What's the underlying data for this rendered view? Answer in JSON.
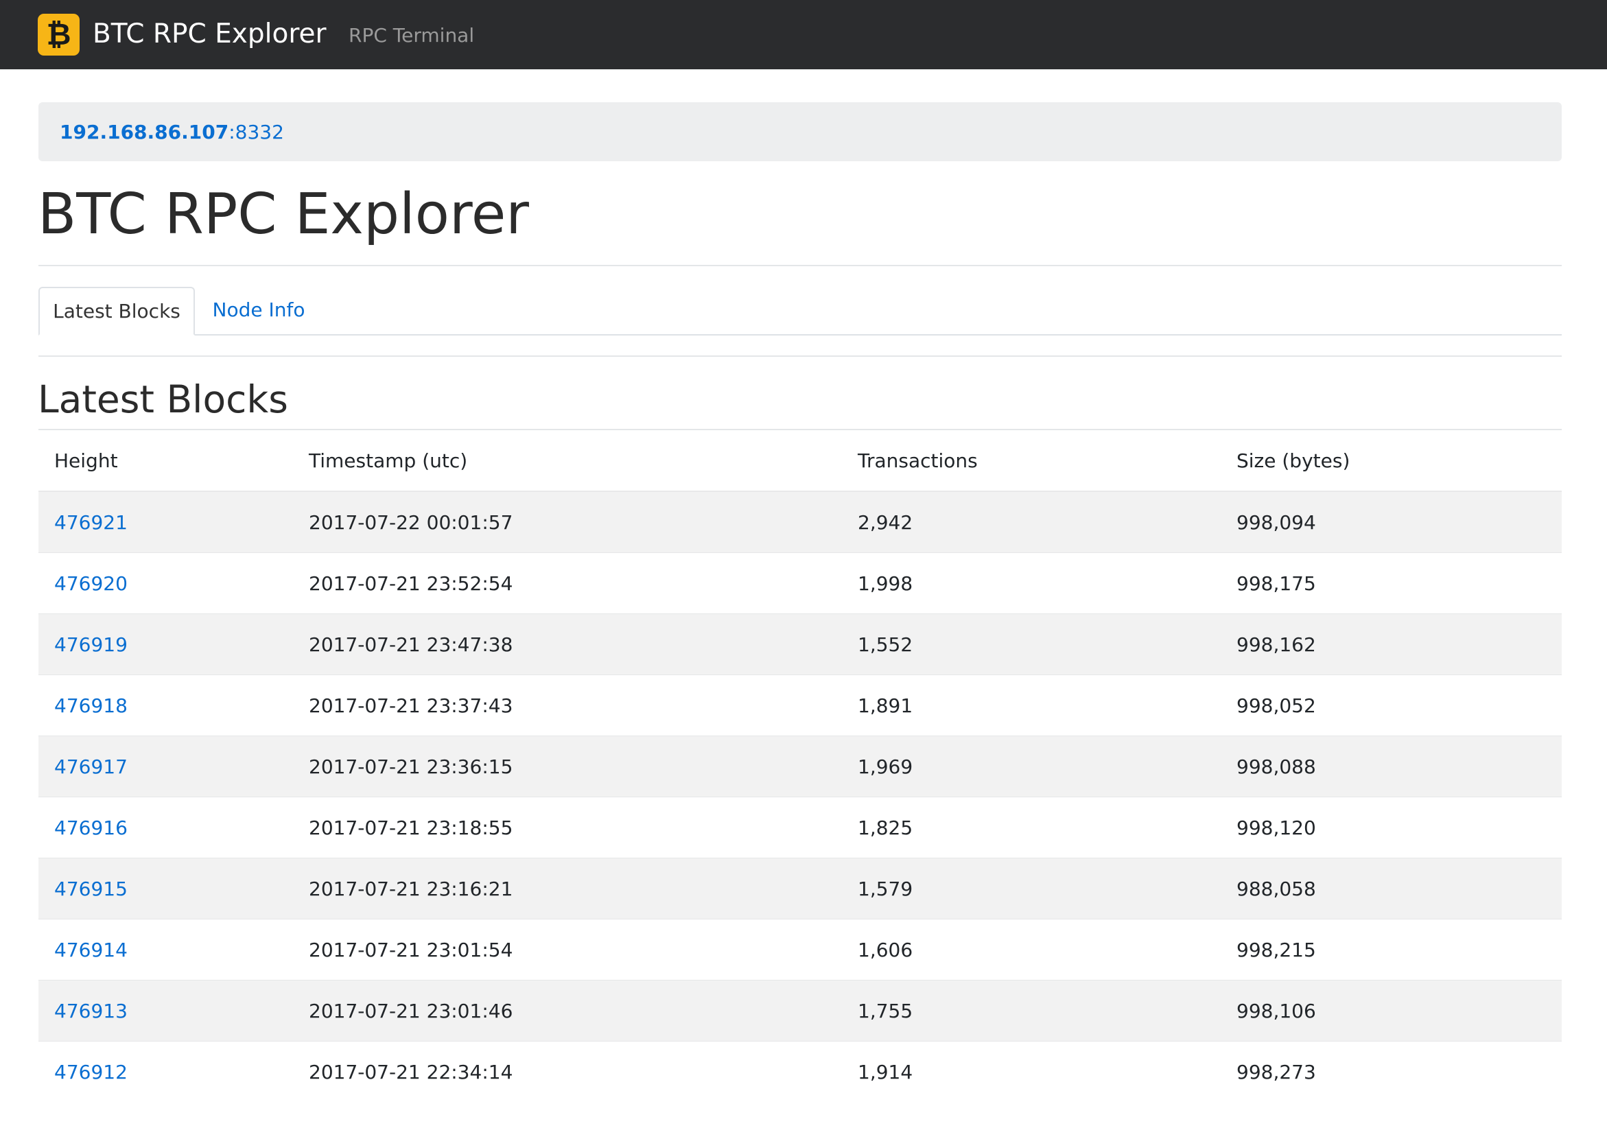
{
  "navbar": {
    "logo_icon": "bitcoin-icon",
    "logo_glyph": "₿",
    "brand": "BTC RPC Explorer",
    "links": [
      "RPC Terminal"
    ]
  },
  "node": {
    "host": "192.168.86.107",
    "port": ":8332"
  },
  "page_title": "BTC RPC Explorer",
  "tabs": [
    {
      "label": "Latest Blocks",
      "active": true
    },
    {
      "label": "Node Info",
      "active": false
    }
  ],
  "section_title": "Latest Blocks",
  "table": {
    "headers": [
      "Height",
      "Timestamp (utc)",
      "Transactions",
      "Size (bytes)"
    ],
    "rows": [
      [
        "476921",
        "2017-07-22 00:01:57",
        "2,942",
        "998,094"
      ],
      [
        "476920",
        "2017-07-21 23:52:54",
        "1,998",
        "998,175"
      ],
      [
        "476919",
        "2017-07-21 23:47:38",
        "1,552",
        "998,162"
      ],
      [
        "476918",
        "2017-07-21 23:37:43",
        "1,891",
        "998,052"
      ],
      [
        "476917",
        "2017-07-21 23:36:15",
        "1,969",
        "998,088"
      ],
      [
        "476916",
        "2017-07-21 23:18:55",
        "1,825",
        "998,120"
      ],
      [
        "476915",
        "2017-07-21 23:16:21",
        "1,579",
        "988,058"
      ],
      [
        "476914",
        "2017-07-21 23:01:54",
        "1,606",
        "998,215"
      ],
      [
        "476913",
        "2017-07-21 23:01:46",
        "1,755",
        "998,106"
      ],
      [
        "476912",
        "2017-07-21 22:34:14",
        "1,914",
        "998,273"
      ]
    ]
  },
  "colors": {
    "navbar_bg": "#2b2c2e",
    "logo_bg": "#f7b516",
    "link": "#0a6ed1",
    "stripe": "#f2f2f2",
    "node_bar_bg": "#edeeef"
  }
}
